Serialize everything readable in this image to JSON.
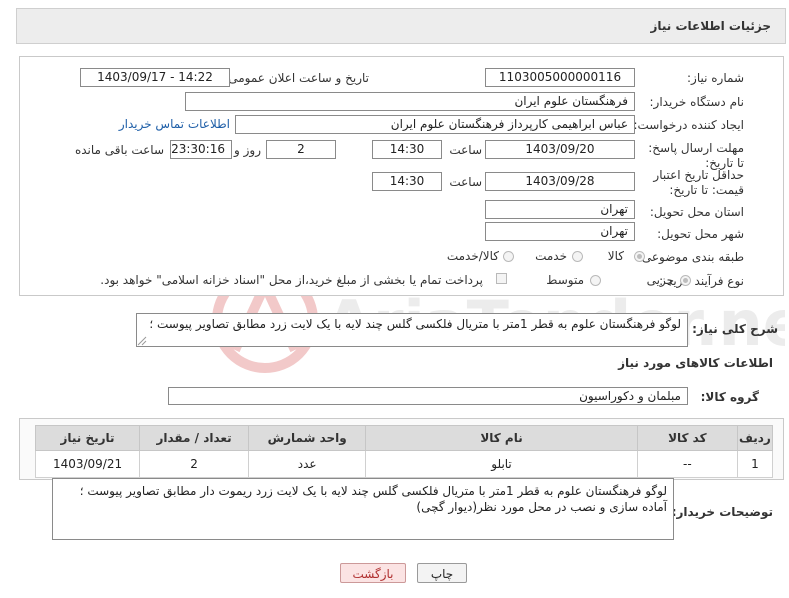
{
  "header": {
    "title": "جزئیات اطلاعات نیاز"
  },
  "info": {
    "need_number_label": "شماره نیاز:",
    "need_number": "1103005000000116",
    "announce_label": "تاریخ و ساعت اعلان عمومی:",
    "announce_value": "1403/09/17 - 14:22",
    "buyer_org_label": "نام دستگاه خریدار:",
    "buyer_org": "فرهنگستان علوم ایران",
    "creator_label": "ایجاد کننده درخواست:",
    "creator": "عباس ابراهیمی کارپرداز فرهنگستان علوم ایران",
    "contact_link": "اطلاعات تماس خریدار",
    "deadline_label": "مهلت ارسال پاسخ: تا تاریخ:",
    "deadline_date": "1403/09/20",
    "time_label": "ساعت",
    "deadline_time": "14:30",
    "days_value": "2",
    "days_label": "روز و",
    "remaining_value": "23:30:16",
    "remaining_label": "ساعت باقی مانده",
    "validity_label": "حداقل تاریخ اعتبار قیمت: تا تاریخ:",
    "validity_date": "1403/09/28",
    "validity_time": "14:30",
    "province_label": "استان محل تحویل:",
    "province": "تهران",
    "city_label": "شهر محل تحویل:",
    "city": "تهران",
    "category_label": "طبقه بندی موضوعی:",
    "category_options": [
      "کالا",
      "خدمت",
      "کالا/خدمت"
    ],
    "purchase_type_label": "نوع فرآیند خرید :",
    "purchase_options": [
      "جزیی",
      "متوسط"
    ],
    "payment_note": "پرداخت تمام یا بخشی از مبلغ خرید،از محل \"اسناد خزانه اسلامی\" خواهد بود."
  },
  "description": {
    "label": "شرح کلی نیاز:",
    "text": "لوگو فرهنگستان علوم به قطر 1متر با متریال فلکسی گلس چند لایه با یک لایت زرد مطابق تصاویر پیوست ؛"
  },
  "goods": {
    "section_title": "اطلاعات کالاهای مورد نیاز",
    "group_label": "گروه کالا:",
    "group_value": "مبلمان و دکوراسیون",
    "columns": [
      "ردیف",
      "کد کالا",
      "نام کالا",
      "واحد شمارش",
      "تعداد / مقدار",
      "تاریخ نیاز"
    ],
    "rows": [
      {
        "row": "1",
        "code": "--",
        "name": "تابلو",
        "unit": "عدد",
        "qty": "2",
        "date": "1403/09/21"
      }
    ]
  },
  "buyer_notes": {
    "label": "توضیحات خریدار:",
    "text": "لوگو فرهنگستان علوم به قطر 1متر با متریال فلکسی گلس چند لایه با یک لایت زرد ریموت دار مطابق تصاویر پیوست ؛ آماده سازی و نصب در محل مورد نظر(دیوار گچی)"
  },
  "buttons": {
    "print": "چاپ",
    "back": "بازگشت"
  },
  "watermark": {
    "text": "AriaTender.net"
  }
}
